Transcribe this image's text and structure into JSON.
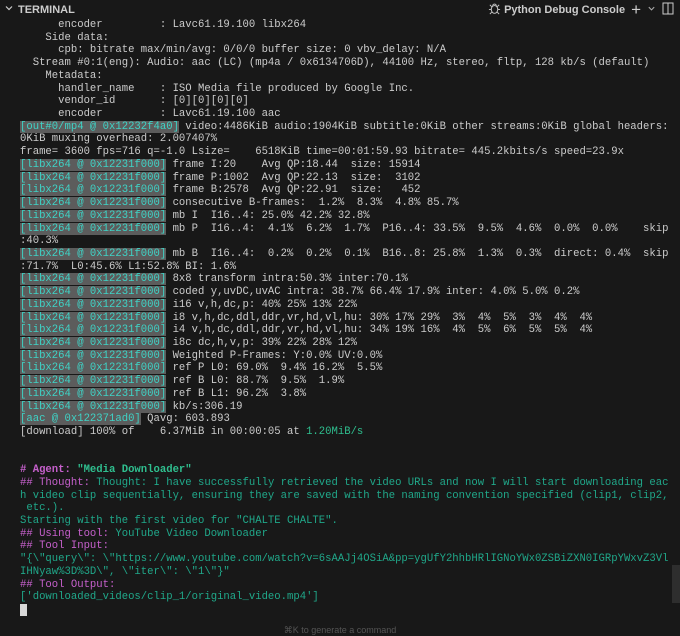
{
  "header": {
    "title": "TERMINAL",
    "console_label": "Python Debug Console",
    "hint": "⌘K to generate a command"
  },
  "colors": {
    "background": "#181818",
    "tag_fg": "#3fd3c6",
    "tag_bg": "#5c5c5c",
    "agent_magenta": "#c660cc",
    "agent_teal": "#20a88a"
  },
  "lines": [
    [
      [
        "      encoder         : Lavc61.19.100 libx264",
        "t"
      ]
    ],
    [
      [
        "    Side data:",
        "t"
      ]
    ],
    [
      [
        "      cpb: bitrate max/min/avg: 0/0/0 buffer size: 0 vbv_delay: N/A",
        "t"
      ]
    ],
    [
      [
        "  Stream #0:1(eng): Audio: aac (LC) (mp4a / 0x6134706D), 44100 Hz, stereo, fltp, 128 kb/s (default)",
        "t"
      ]
    ],
    [
      [
        "    Metadata:",
        "t"
      ]
    ],
    [
      [
        "      handler_name    : ISO Media file produced by Google Inc.",
        "t"
      ]
    ],
    [
      [
        "      vendor_id       : [0][0][0][0]",
        "t"
      ]
    ],
    [
      [
        "      encoder         : Lavc61.19.100 aac",
        "t"
      ]
    ],
    [
      [
        "[out#0/mp4 @ 0x12232f4a0]",
        "tag tagw"
      ],
      [
        " video:4486KiB audio:1904KiB subtitle:0KiB other streams:0KiB global headers:",
        "t"
      ]
    ],
    [
      [
        "0KiB muxing overhead: 2.007407%",
        "t"
      ]
    ],
    [
      [
        "frame= 3600 fps=716 q=-1.0 Lsize=    6518KiB time=00:01:59.93 bitrate= 445.2kbits/s speed=23.9x",
        "t"
      ]
    ],
    [
      [
        "[libx264 @ 0x12231f000]",
        "tag"
      ],
      [
        " frame I:20    Avg QP:18.44  size: 15914",
        "t"
      ]
    ],
    [
      [
        "[libx264 @ 0x12231f000]",
        "tag"
      ],
      [
        " frame P:1002  Avg QP:22.13  size:  3102",
        "t"
      ]
    ],
    [
      [
        "[libx264 @ 0x12231f000]",
        "tag"
      ],
      [
        " frame B:2578  Avg QP:22.91  size:   452",
        "t"
      ]
    ],
    [
      [
        "[libx264 @ 0x12231f000]",
        "tag"
      ],
      [
        " consecutive B-frames:  1.2%  8.3%  4.8% 85.7%",
        "t"
      ]
    ],
    [
      [
        "[libx264 @ 0x12231f000]",
        "tag"
      ],
      [
        " mb I  I16..4: 25.0% 42.2% 32.8%",
        "t"
      ]
    ],
    [
      [
        "[libx264 @ 0x12231f000]",
        "tag"
      ],
      [
        " mb P  I16..4:  4.1%  6.2%  1.7%  P16..4: 33.5%  9.5%  4.6%  0.0%  0.0%    skip",
        "t"
      ]
    ],
    [
      [
        ":40.3%",
        "t"
      ]
    ],
    [
      [
        "[libx264 @ 0x12231f000]",
        "tag"
      ],
      [
        " mb B  I16..4:  0.2%  0.2%  0.1%  B16..8: 25.8%  1.3%  0.3%  direct: 0.4%  skip",
        "t"
      ]
    ],
    [
      [
        ":71.7%  L0:45.6% L1:52.8% BI: 1.6%",
        "t"
      ]
    ],
    [
      [
        "[libx264 @ 0x12231f000]",
        "tag"
      ],
      [
        " 8x8 transform intra:50.3% inter:70.1%",
        "t"
      ]
    ],
    [
      [
        "[libx264 @ 0x12231f000]",
        "tag"
      ],
      [
        " coded y,uvDC,uvAC intra: 38.7% 66.4% 17.9% inter: 4.0% 5.0% 0.2%",
        "t"
      ]
    ],
    [
      [
        "[libx264 @ 0x12231f000]",
        "tag"
      ],
      [
        " i16 v,h,dc,p: 40% 25% 13% 22%",
        "t"
      ]
    ],
    [
      [
        "[libx264 @ 0x12231f000]",
        "tag"
      ],
      [
        " i8 v,h,dc,ddl,ddr,vr,hd,vl,hu: 30% 17% 29%  3%  4%  5%  3%  4%  4%",
        "t"
      ]
    ],
    [
      [
        "[libx264 @ 0x12231f000]",
        "tag"
      ],
      [
        " i4 v,h,dc,ddl,ddr,vr,hd,vl,hu: 34% 19% 16%  4%  5%  6%  5%  5%  4%",
        "t"
      ]
    ],
    [
      [
        "[libx264 @ 0x12231f000]",
        "tag"
      ],
      [
        " i8c dc,h,v,p: 39% 22% 28% 12%",
        "t"
      ]
    ],
    [
      [
        "[libx264 @ 0x12231f000]",
        "tag"
      ],
      [
        " Weighted P-Frames: Y:0.0% UV:0.0%",
        "t"
      ]
    ],
    [
      [
        "[libx264 @ 0x12231f000]",
        "tag"
      ],
      [
        " ref P L0: 69.0%  9.4% 16.2%  5.5%",
        "t"
      ]
    ],
    [
      [
        "[libx264 @ 0x12231f000]",
        "tag"
      ],
      [
        " ref B L0: 88.7%  9.5%  1.9%",
        "t"
      ]
    ],
    [
      [
        "[libx264 @ 0x12231f000]",
        "tag"
      ],
      [
        " ref B L1: 96.2%  3.8%",
        "t"
      ]
    ],
    [
      [
        "[libx264 @ 0x12231f000]",
        "tag"
      ],
      [
        " kb/s:306.19",
        "t"
      ]
    ],
    [
      [
        "[aac @ 0x122371ad0]",
        "tag"
      ],
      [
        " Qavg: 603.893",
        "t"
      ]
    ],
    [
      [
        "[download] 100% of    6.37MiB in 00:00:05 at ",
        "t"
      ],
      [
        "1.20MiB/s",
        "grn"
      ]
    ],
    [
      [
        "",
        "t"
      ]
    ],
    [
      [
        "",
        "t"
      ]
    ],
    [
      [
        "# Agent: ",
        "mag b"
      ],
      [
        "\"Media Downloader\"",
        "grn b"
      ]
    ],
    [
      [
        "## Thought: ",
        "mag"
      ],
      [
        "Thought: I have successfully retrieved the video URLs and now I will start downloading eac",
        "teal"
      ]
    ],
    [
      [
        "h video clip sequentially, ensuring they are saved with the naming convention specified (clip1, clip2,",
        "teal"
      ]
    ],
    [
      [
        " etc.).",
        "teal"
      ]
    ],
    [
      [
        "Starting with the first video for \"CHALTE CHALTE\".",
        "teal"
      ]
    ],
    [
      [
        "## Using tool: ",
        "mag"
      ],
      [
        "YouTube Video Downloader",
        "teal"
      ]
    ],
    [
      [
        "## Tool Input:",
        "mag"
      ]
    ],
    [
      [
        "\"{\\\"query\\\": \\\"https://www.youtube.com/watch?v=6sAAJj4OSiA&pp=ygUfY2hhbHRlIGNoYWx0ZSBiZXN0IGRpYWxvZ3Vl",
        "teal"
      ]
    ],
    [
      [
        "IHNyaw%3D%3D\\\", \\\"iter\\\": \\\"1\\\"}\"",
        "teal"
      ]
    ],
    [
      [
        "## Tool Output:",
        "mag"
      ]
    ],
    [
      [
        "['downloaded_videos/clip_1/original_video.mp4']",
        "teal"
      ]
    ]
  ]
}
